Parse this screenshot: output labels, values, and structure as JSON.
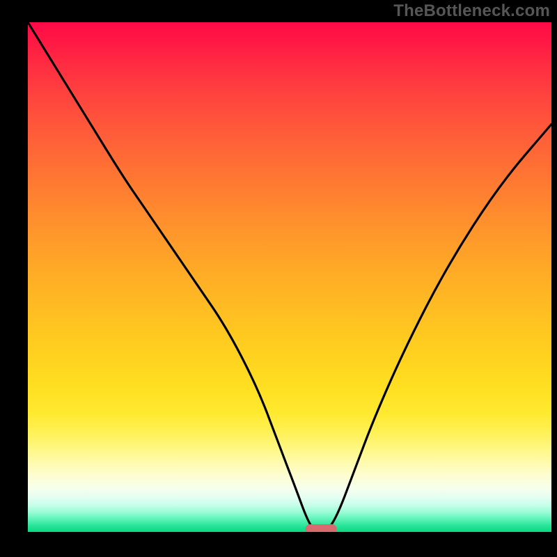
{
  "watermark": "TheBottleneck.com",
  "chart_data": {
    "type": "line",
    "title": "",
    "xlabel": "",
    "ylabel": "",
    "xlim": [
      0,
      100
    ],
    "ylim": [
      0,
      100
    ],
    "grid": false,
    "legend": false,
    "background": "heatmap-gradient",
    "series": [
      {
        "name": "bottleneck-curve",
        "x": [
          0,
          6,
          12,
          18,
          22,
          26,
          32,
          38,
          44,
          48,
          51,
          53.5,
          55,
          57,
          59,
          62,
          66,
          72,
          80,
          90,
          100
        ],
        "y": [
          100,
          90,
          80,
          70,
          64,
          58,
          49,
          40,
          28,
          17,
          9,
          2,
          0,
          0,
          3,
          11,
          22,
          36,
          52,
          68,
          80
        ]
      }
    ],
    "marker": {
      "name": "optimum-pill",
      "x": 56,
      "width": 6,
      "y": 0,
      "color": "#d86b6f"
    },
    "gradient_stops": [
      {
        "pos": 0.0,
        "color": "#ff0a46"
      },
      {
        "pos": 0.5,
        "color": "#ffab26"
      },
      {
        "pos": 0.8,
        "color": "#fff050"
      },
      {
        "pos": 0.92,
        "color": "#e3fef2"
      },
      {
        "pos": 1.0,
        "color": "#08d982"
      }
    ]
  }
}
